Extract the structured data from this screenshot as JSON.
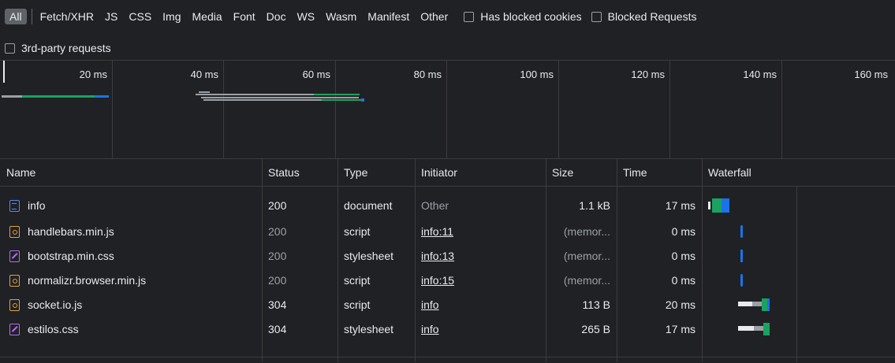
{
  "filters": {
    "types": [
      "All",
      "Fetch/XHR",
      "JS",
      "CSS",
      "Img",
      "Media",
      "Font",
      "Doc",
      "WS",
      "Wasm",
      "Manifest",
      "Other"
    ],
    "active": "All",
    "has_blocked_cookies": "Has blocked cookies",
    "blocked_requests": "Blocked Requests",
    "third_party": "3rd-party requests"
  },
  "overview": {
    "ticks": [
      "20 ms",
      "40 ms",
      "60 ms",
      "80 ms",
      "100 ms",
      "120 ms",
      "140 ms",
      "160 ms"
    ]
  },
  "table": {
    "columns": [
      "Name",
      "Status",
      "Type",
      "Initiator",
      "Size",
      "Time",
      "Waterfall"
    ],
    "rows": [
      {
        "icon": "document-icon",
        "name": "info",
        "status": "200",
        "type": "document",
        "initiator": "Other",
        "size": "1.1 kB",
        "time": "17 ms"
      },
      {
        "icon": "script-icon",
        "name": "handlebars.min.js",
        "status": "200",
        "type": "script",
        "initiator": "info:11",
        "size": "(memor...",
        "time": "0 ms"
      },
      {
        "icon": "stylesheet-icon",
        "name": "bootstrap.min.css",
        "status": "200",
        "type": "stylesheet",
        "initiator": "info:13",
        "size": "(memor...",
        "time": "0 ms"
      },
      {
        "icon": "script-icon",
        "name": "normalizr.browser.min.js",
        "status": "200",
        "type": "script",
        "initiator": "info:15",
        "size": "(memor...",
        "time": "0 ms"
      },
      {
        "icon": "script-icon",
        "name": "socket.io.js",
        "status": "304",
        "type": "script",
        "initiator": "info",
        "size": "113 B",
        "time": "20 ms"
      },
      {
        "icon": "stylesheet-icon",
        "name": "estilos.css",
        "status": "304",
        "type": "stylesheet",
        "initiator": "info",
        "size": "265 B",
        "time": "17 ms"
      }
    ]
  },
  "colors": {
    "background": "#202124",
    "waiting": "#1aa260",
    "download": "#1a73e8",
    "queued": "#e8eaed",
    "stalled": "#9aa0a6"
  }
}
